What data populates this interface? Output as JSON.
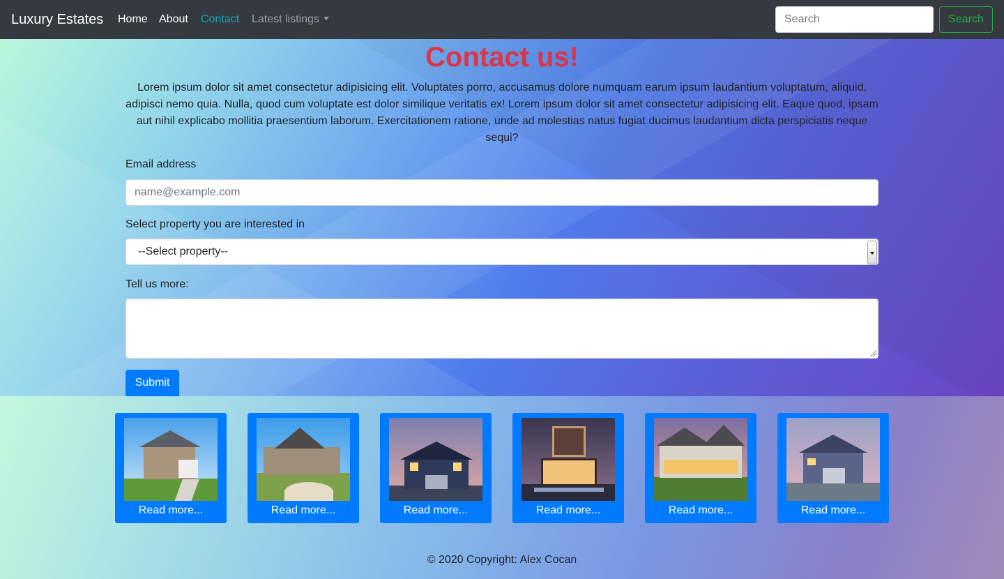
{
  "navbar": {
    "brand": "Luxury Estates",
    "links": [
      "Home",
      "About",
      "Contact",
      "Latest listings"
    ],
    "active": "Contact",
    "search": {
      "placeholder": "Search",
      "button": "Search"
    }
  },
  "main": {
    "title": "Contact us!",
    "intro": "Lorem ipsum dolor sit amet consectetur adipisicing elit. Voluptates porro, accusamus dolore numquam earum ipsum laudantium voluptatum, aliquid, adipisci nemo quia. Nulla, quod cum voluptate est dolor similique veritatis ex! Lorem ipsum dolor sit amet consectetur adipisicing elit. Eaque quod, ipsam aut nihil explicabo mollitia praesentium laborum. Exercitationem ratione, unde ad molestias natus fugiat ducimus laudantium dicta perspiciatis neque sequi?",
    "form": {
      "email_label": "Email address",
      "email_placeholder": "name@example.com",
      "select_label": "Select property you are interested in",
      "select_value": "--Select property--",
      "more_label": "Tell us more:",
      "more_value": "",
      "submit": "Submit"
    }
  },
  "listings": [
    {
      "link": "Read more..."
    },
    {
      "link": "Read more..."
    },
    {
      "link": "Read more..."
    },
    {
      "link": "Read more..."
    },
    {
      "link": "Read more..."
    },
    {
      "link": "Read more..."
    }
  ],
  "footer": "© 2020 Copyright: Alex Cocan",
  "colors": {
    "navbar": "#343a40",
    "accent": "#007bff",
    "title": "#dc3545",
    "active_link": "#17a2b8",
    "success": "#28a745"
  }
}
